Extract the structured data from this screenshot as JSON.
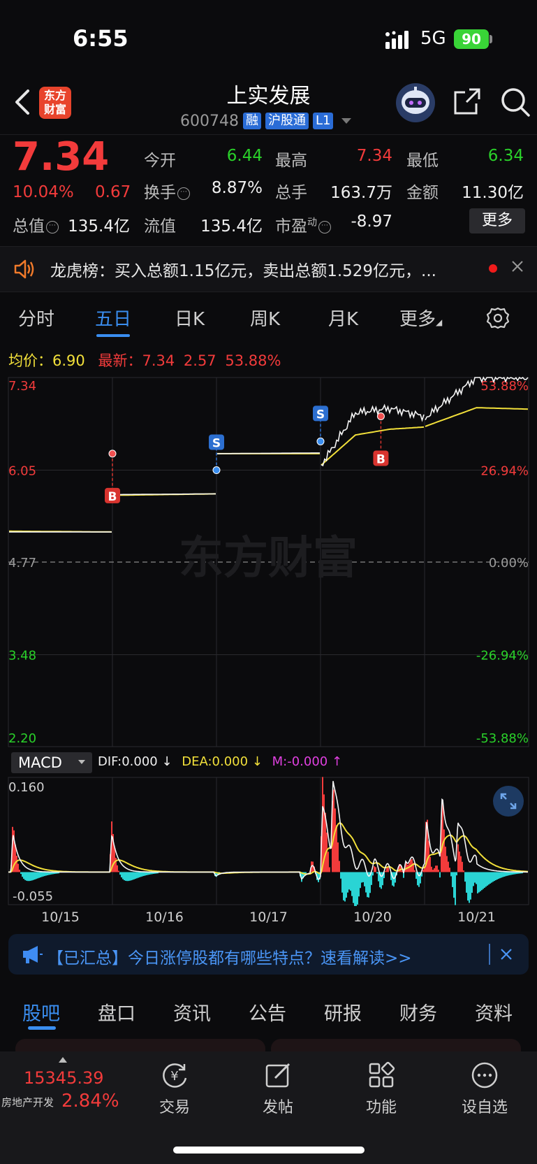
{
  "status_bar": {
    "time": "6:55",
    "network": "5G",
    "battery": "90"
  },
  "header": {
    "logo_line1": "东方",
    "logo_line2": "财富",
    "stock_name": "上实发展",
    "stock_code": "600748",
    "tags": [
      "融",
      "沪股通",
      "L1"
    ]
  },
  "quote": {
    "price": "7.34",
    "change_pct": "10.04%",
    "change_amt": "0.67",
    "open_label": "今开",
    "open_value": "6.44",
    "high_label": "最高",
    "high_value": "7.34",
    "low_label": "最低",
    "low_value": "6.34",
    "turnover_label": "换手",
    "turnover_value": "8.87%",
    "volume_label": "总手",
    "volume_value": "163.7万",
    "amount_label": "金额",
    "amount_value": "11.30亿",
    "mcap_label": "总值",
    "mcap_value": "135.4亿",
    "float_label": "流值",
    "float_value": "135.4亿",
    "pe_label": "市盈",
    "pe_sup": "动",
    "pe_value": "-8.97",
    "more_label": "更多"
  },
  "notice": {
    "text": "龙虎榜：买入总额1.15亿元，卖出总额1.529亿元，..."
  },
  "chart_tabs": [
    "分时",
    "五日",
    "日K",
    "周K",
    "月K",
    "更多"
  ],
  "active_chart_tab": "五日",
  "avg_row": {
    "avg_label": "均价：6.90",
    "latest_label": "最新：7.34",
    "change": "2.57",
    "change_pct": "53.88%"
  },
  "macd": {
    "indicator": "MACD",
    "dif": "DIF:0.000 ↓",
    "dea": "DEA:0.000 ↓",
    "m": "M:-0.000 ↑",
    "y_top": "0.160",
    "y_bottom": "-0.055"
  },
  "chart_data": {
    "type": "line",
    "title": "",
    "price_axis": [
      "7.34",
      "6.05",
      "4.77",
      "3.48",
      "2.20"
    ],
    "pct_axis": [
      "53.88%",
      "26.94%",
      "0.00%",
      "-26.94%",
      "-53.88%"
    ],
    "ylim": [
      2.2,
      7.34
    ],
    "base_price": 4.77,
    "dates": [
      "10/15",
      "10/16",
      "10/17",
      "10/20",
      "10/21"
    ],
    "grid": true,
    "series": [
      {
        "values_per_day": [
          [
            5.19,
            5.19
          ],
          [
            5.71,
            5.72
          ],
          [
            6.28,
            6.29
          ],
          [
            6.12,
            6.85,
            6.91,
            6.8
          ],
          [
            6.78,
            7.34,
            7.34
          ]
        ]
      },
      {
        "values_per_day": [
          [
            5.2,
            5.19
          ],
          [
            5.7,
            5.72
          ],
          [
            6.28,
            6.28
          ],
          [
            6.12,
            6.54,
            6.62,
            6.65
          ],
          [
            6.66,
            6.92,
            6.9
          ]
        ]
      }
    ],
    "markers": [
      {
        "label": "B",
        "date": "10/16",
        "price": 6.28
      },
      {
        "label": "S",
        "date": "10/17",
        "price": 6.05
      },
      {
        "label": "B",
        "date": "10/20",
        "price": 6.8
      },
      {
        "label": "S",
        "date": "10/20",
        "price": 6.45
      }
    ],
    "colors": {
      "price": "#f5f5f5",
      "avg": "#f2e03a",
      "up": "#f23b3b",
      "down": "#2ad4d4"
    }
  },
  "promo": {
    "text": "【已汇总】今日涨停股都有哪些特点？速看解读>>"
  },
  "info_tabs": [
    "股吧",
    "盘口",
    "资讯",
    "公告",
    "研报",
    "财务",
    "资料"
  ],
  "active_info_tab": "股吧",
  "bottom_nav": {
    "index_value": "15345.39",
    "index_name": "房地产开发",
    "index_pct": "2.84%",
    "items": [
      "交易",
      "发帖",
      "功能",
      "设自选"
    ]
  }
}
